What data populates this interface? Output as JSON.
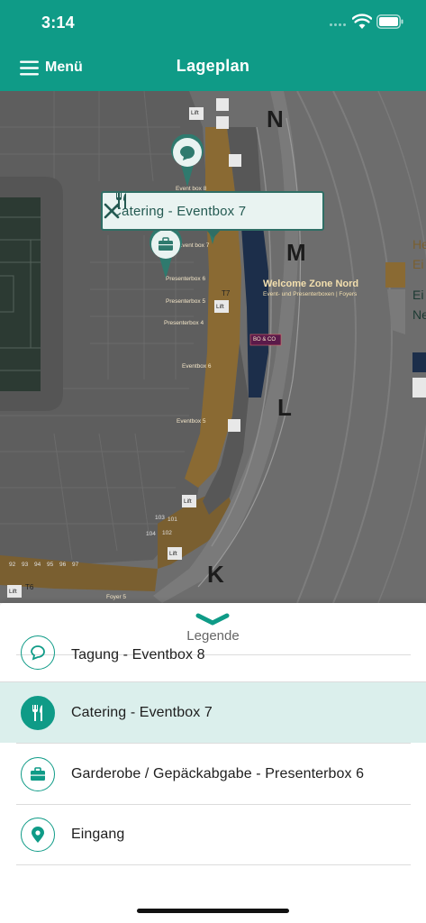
{
  "status_bar": {
    "time": "3:14"
  },
  "header": {
    "menu_label": "Menü",
    "title": "Lageplan"
  },
  "map": {
    "callout": {
      "label": "Catering - Eventbox 7"
    },
    "sector_letters": [
      "N",
      "M",
      "L",
      "K"
    ],
    "labels": [
      "Lift",
      "Lift",
      "Lift",
      "Lift",
      "Lift",
      "Event box 8",
      "Event box 7",
      "Presenterbox 6",
      "Presenterbox 5",
      "Presenterbox 4",
      "Eventbox 6",
      "Eventbox 5",
      "Foyer 5",
      "BO & CO",
      "T7",
      "T6"
    ],
    "welcome_zone": {
      "title": "Welcome Zone Nord",
      "subtitle": "Event- und Presenterboxen | Foyers"
    },
    "side_texts": [
      "He",
      "Ei",
      "Ei",
      "Ne"
    ],
    "seat_numbers": [
      "101",
      "102",
      "103",
      "104",
      "92",
      "93",
      "94",
      "95",
      "96",
      "97"
    ]
  },
  "legend": {
    "title": "Legende",
    "items": [
      {
        "label": "Tagung - Eventbox 8",
        "icon": "speech-bubble-icon"
      },
      {
        "label": "Catering - Eventbox 7",
        "icon": "fork-knife-icon",
        "selected": true
      },
      {
        "label": "Garderobe / Gepäckabgabe - Presenterbox 6",
        "icon": "briefcase-icon"
      },
      {
        "label": "Eingang",
        "icon": "location-pin-icon"
      }
    ]
  },
  "colors": {
    "brand": "#0f9b87",
    "selected_bg": "#dbefec",
    "box_gold": "#8a6a33",
    "box_blue": "#1c2e4a"
  }
}
